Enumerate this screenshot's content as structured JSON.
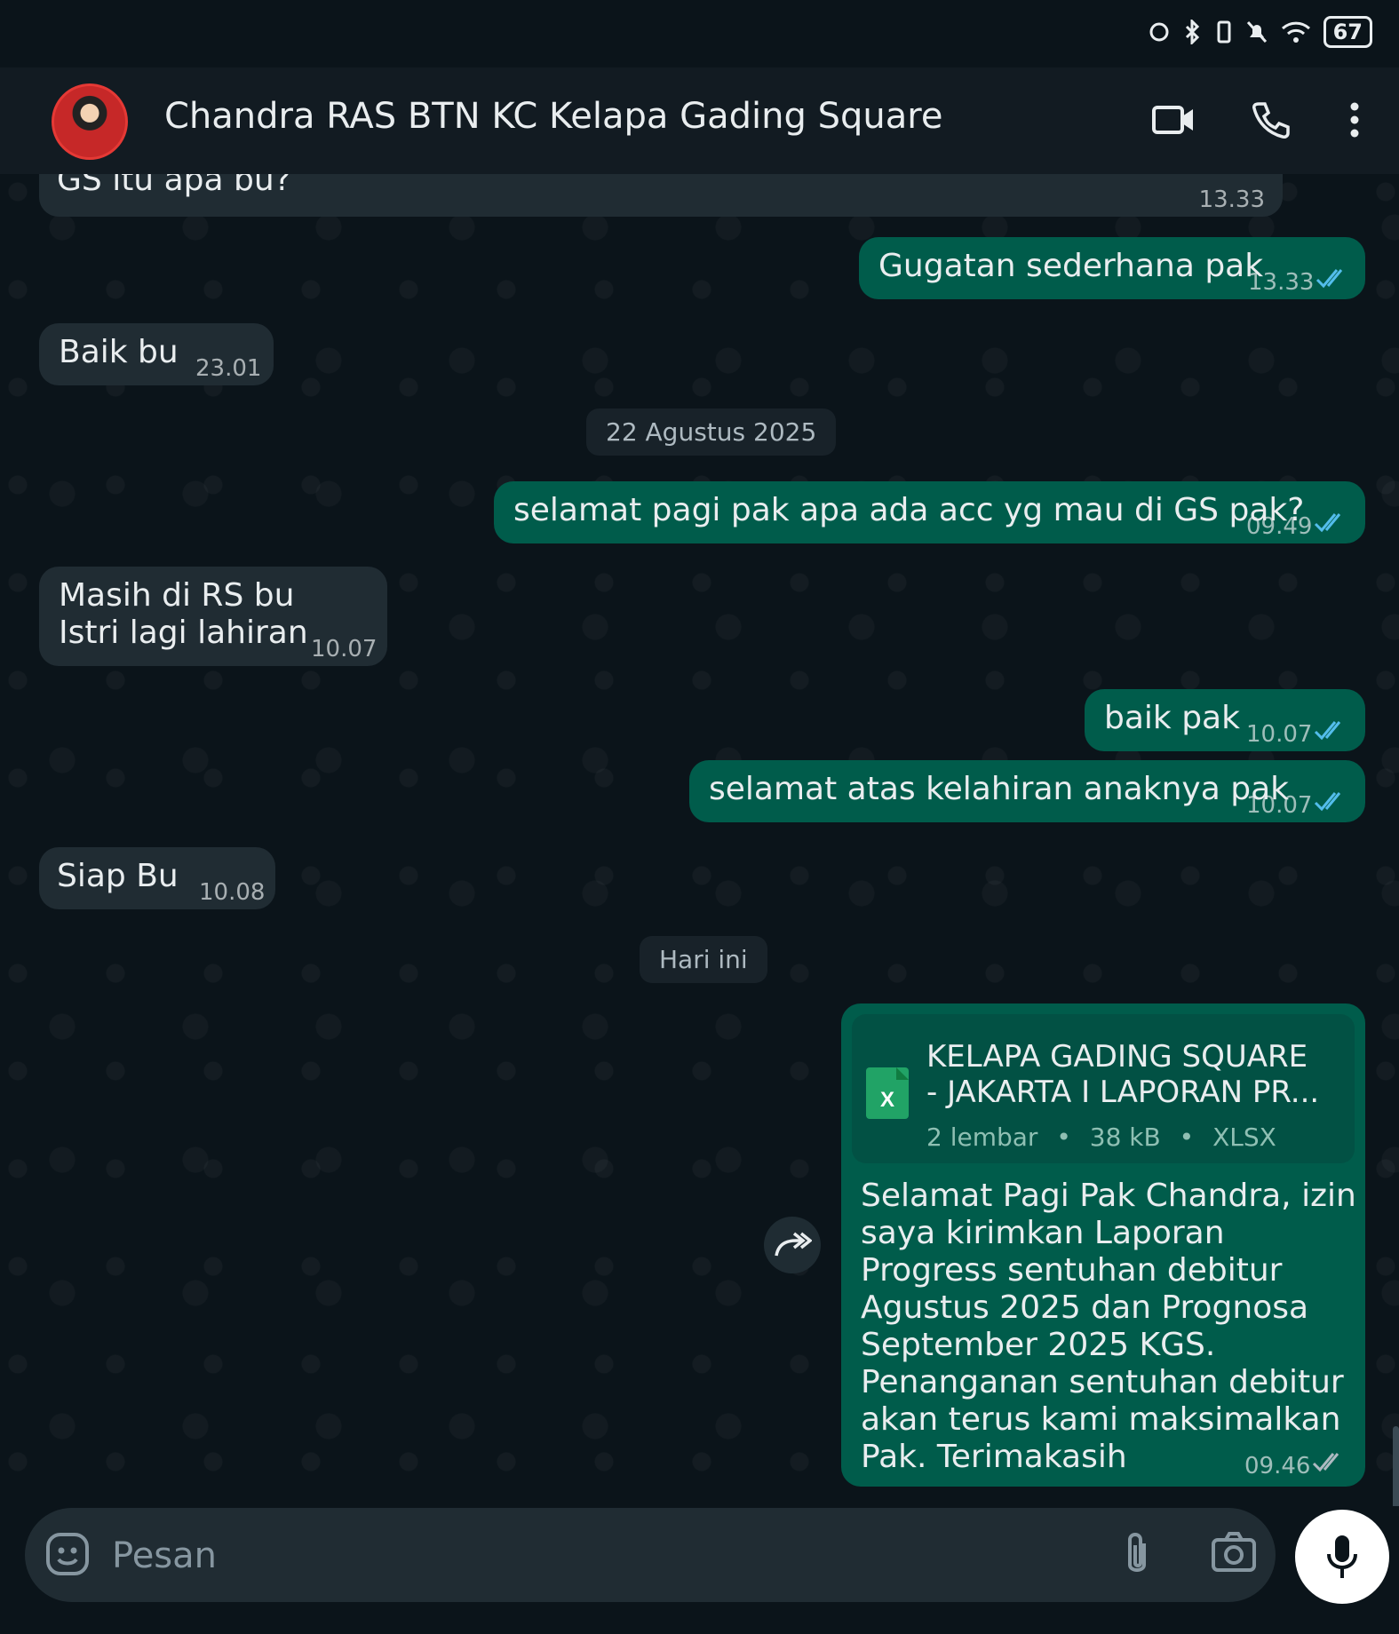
{
  "status_bar": {
    "battery": "67"
  },
  "header": {
    "contact_name": "Chandra RAS BTN KC Kelapa Gading Square"
  },
  "messages": [
    {
      "text": "GS itu apa bu?",
      "time": "13.33"
    },
    {
      "text": "Gugatan sederhana pak",
      "time": "13.33"
    },
    {
      "text": "Baik bu",
      "time": "23.01"
    },
    {
      "text": "selamat pagi pak apa ada acc yg mau di GS pak?",
      "time": "09.49"
    },
    {
      "line1": "Masih di RS bu",
      "line2": "Istri lagi lahiran",
      "time": "10.07"
    },
    {
      "text": "baik pak",
      "time": "10.07"
    },
    {
      "text": "selamat atas kelahiran anaknya pak",
      "time": "10.07"
    },
    {
      "text": "Siap Bu",
      "time": "10.08"
    },
    {
      "file_name_line1": "KELAPA GADING SQUARE",
      "file_name_line2": "- JAKARTA I LAPORAN PR...",
      "file_pages": "2 lembar",
      "file_size": "38 kB",
      "file_type": "XLSX",
      "text": "Selamat Pagi Pak Chandra, izin saya kirimkan Laporan Progress sentuhan debitur Agustus 2025 dan Prognosa September 2025 KGS. Penanganan sentuhan debitur akan terus kami maksimalkan Pak. Terimakasih",
      "time": "09.46"
    }
  ],
  "date_separators": [
    "22 Agustus 2025",
    "Hari ini"
  ],
  "composer": {
    "placeholder": "Pesan"
  },
  "colors": {
    "incoming": "#202c33",
    "outgoing": "#005c4b",
    "read_tick": "#53bdeb",
    "background": "#0b141a"
  },
  "icons": [
    "video-call-icon",
    "voice-call-icon",
    "more-options-icon",
    "forward-icon",
    "emoji-icon",
    "attach-icon",
    "camera-icon",
    "mic-icon",
    "xlsx-file-icon"
  ]
}
